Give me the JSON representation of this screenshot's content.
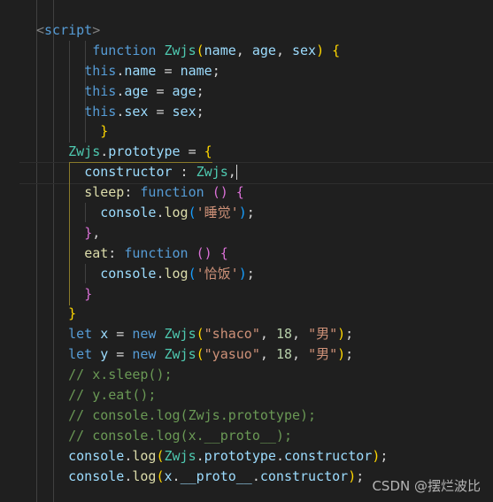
{
  "colors": {
    "background": "#1f1f1f",
    "keyword": "#569cd6",
    "class": "#4ec9b0",
    "variable": "#9cdcfe",
    "function": "#dcdcaa",
    "string": "#ce9178",
    "number": "#b5cea8",
    "comment": "#6a9955"
  },
  "code_lines": [
    [
      [
        "<",
        "t"
      ],
      [
        "script",
        "k"
      ],
      [
        ">",
        "t"
      ]
    ],
    [
      [
        "       ",
        "p"
      ],
      [
        "function ",
        "k"
      ],
      [
        "Zwjs",
        "c"
      ],
      [
        "(",
        "b1"
      ],
      [
        "name",
        "v"
      ],
      [
        ", ",
        "p"
      ],
      [
        "age",
        "v"
      ],
      [
        ", ",
        "p"
      ],
      [
        "sex",
        "v"
      ],
      [
        ")",
        "b1"
      ],
      [
        " ",
        "p"
      ],
      [
        "{",
        "b1"
      ]
    ],
    [
      [
        "      ",
        "p"
      ],
      [
        "this",
        "k"
      ],
      [
        ".",
        "p"
      ],
      [
        "name",
        "v"
      ],
      [
        " = ",
        "p"
      ],
      [
        "name",
        "v"
      ],
      [
        ";",
        "p"
      ]
    ],
    [
      [
        "      ",
        "p"
      ],
      [
        "this",
        "k"
      ],
      [
        ".",
        "p"
      ],
      [
        "age",
        "v"
      ],
      [
        " = ",
        "p"
      ],
      [
        "age",
        "v"
      ],
      [
        ";",
        "p"
      ]
    ],
    [
      [
        "      ",
        "p"
      ],
      [
        "this",
        "k"
      ],
      [
        ".",
        "p"
      ],
      [
        "sex",
        "v"
      ],
      [
        " = ",
        "p"
      ],
      [
        "sex",
        "v"
      ],
      [
        ";",
        "p"
      ]
    ],
    [
      [
        "        ",
        "p"
      ],
      [
        "}",
        "b1"
      ]
    ],
    [
      [
        "    ",
        "p"
      ],
      [
        "Zwjs",
        "c"
      ],
      [
        ".",
        "p"
      ],
      [
        "prototype",
        "v"
      ],
      [
        " = ",
        "p"
      ],
      [
        "{",
        "b1"
      ]
    ],
    [
      [
        "      ",
        "p"
      ],
      [
        "constructor",
        "v"
      ],
      [
        " : ",
        "p"
      ],
      [
        "Zwjs",
        "c"
      ],
      [
        ",",
        "p"
      ]
    ],
    [
      [
        "      ",
        "p"
      ],
      [
        "sleep",
        "f"
      ],
      [
        ": ",
        "p"
      ],
      [
        "function ",
        "k"
      ],
      [
        "()",
        "b2"
      ],
      [
        " ",
        "p"
      ],
      [
        "{",
        "b2"
      ]
    ],
    [
      [
        "        ",
        "p"
      ],
      [
        "console",
        "v"
      ],
      [
        ".",
        "p"
      ],
      [
        "log",
        "f"
      ],
      [
        "(",
        "b3"
      ],
      [
        "'睡觉'",
        "s"
      ],
      [
        ")",
        "b3"
      ],
      [
        ";",
        "p"
      ]
    ],
    [
      [
        "      ",
        "p"
      ],
      [
        "}",
        "b2"
      ],
      [
        ",",
        "p"
      ]
    ],
    [
      [
        "      ",
        "p"
      ],
      [
        "eat",
        "f"
      ],
      [
        ": ",
        "p"
      ],
      [
        "function ",
        "k"
      ],
      [
        "()",
        "b2"
      ],
      [
        " ",
        "p"
      ],
      [
        "{",
        "b2"
      ]
    ],
    [
      [
        "        ",
        "p"
      ],
      [
        "console",
        "v"
      ],
      [
        ".",
        "p"
      ],
      [
        "log",
        "f"
      ],
      [
        "(",
        "b3"
      ],
      [
        "'恰饭'",
        "s"
      ],
      [
        ")",
        "b3"
      ],
      [
        ";",
        "p"
      ]
    ],
    [
      [
        "      ",
        "p"
      ],
      [
        "}",
        "b2"
      ]
    ],
    [
      [
        "    ",
        "p"
      ],
      [
        "}",
        "b1"
      ]
    ],
    [
      [
        "    ",
        "p"
      ],
      [
        "let ",
        "k"
      ],
      [
        "x",
        "v"
      ],
      [
        " = ",
        "p"
      ],
      [
        "new ",
        "k"
      ],
      [
        "Zwjs",
        "c"
      ],
      [
        "(",
        "b1"
      ],
      [
        "\"shaco\"",
        "s"
      ],
      [
        ", ",
        "p"
      ],
      [
        "18",
        "n"
      ],
      [
        ", ",
        "p"
      ],
      [
        "\"男\"",
        "s"
      ],
      [
        ")",
        "b1"
      ],
      [
        ";",
        "p"
      ]
    ],
    [
      [
        "    ",
        "p"
      ],
      [
        "let ",
        "k"
      ],
      [
        "y",
        "v"
      ],
      [
        " = ",
        "p"
      ],
      [
        "new ",
        "k"
      ],
      [
        "Zwjs",
        "c"
      ],
      [
        "(",
        "b1"
      ],
      [
        "\"yasuo\"",
        "s"
      ],
      [
        ", ",
        "p"
      ],
      [
        "18",
        "n"
      ],
      [
        ", ",
        "p"
      ],
      [
        "\"男\"",
        "s"
      ],
      [
        ")",
        "b1"
      ],
      [
        ";",
        "p"
      ]
    ],
    [
      [
        "    ",
        "p"
      ],
      [
        "// x.sleep();",
        "cm"
      ]
    ],
    [
      [
        "    ",
        "p"
      ],
      [
        "// y.eat();",
        "cm"
      ]
    ],
    [
      [
        "    ",
        "p"
      ],
      [
        "// console.log(Zwjs.prototype);",
        "cm"
      ]
    ],
    [
      [
        "    ",
        "p"
      ],
      [
        "// console.log(x.__proto__);",
        "cm"
      ]
    ],
    [
      [
        "    ",
        "p"
      ],
      [
        "console",
        "v"
      ],
      [
        ".",
        "p"
      ],
      [
        "log",
        "f"
      ],
      [
        "(",
        "b1"
      ],
      [
        "Zwjs",
        "c"
      ],
      [
        ".",
        "p"
      ],
      [
        "prototype",
        "v"
      ],
      [
        ".",
        "p"
      ],
      [
        "constructor",
        "v"
      ],
      [
        ")",
        "b1"
      ],
      [
        ";",
        "p"
      ]
    ],
    [
      [
        "    ",
        "p"
      ],
      [
        "console",
        "v"
      ],
      [
        ".",
        "p"
      ],
      [
        "log",
        "f"
      ],
      [
        "(",
        "b1"
      ],
      [
        "x",
        "v"
      ],
      [
        ".",
        "p"
      ],
      [
        "__proto__",
        "v"
      ],
      [
        ".",
        "p"
      ],
      [
        "constructor",
        "v"
      ],
      [
        ")",
        "b1"
      ],
      [
        ";",
        "p"
      ]
    ]
  ],
  "watermark": "CSDN @摆烂波比"
}
